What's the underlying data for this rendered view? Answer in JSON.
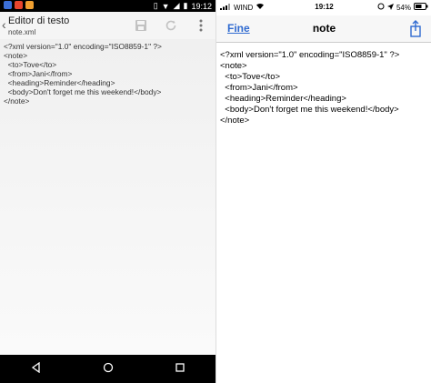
{
  "android": {
    "status_time": "19:12",
    "title": "Editor di testo",
    "subtitle": "note.xml",
    "content_lines": [
      "<?xml version=\"1.0\" encoding=\"ISO8859-1\" ?>",
      "<note>",
      "  <to>Tove</to>",
      "  <from>Jani</from>",
      "  <heading>Reminder</heading>",
      "  <body>Don't forget me this weekend!</body>",
      "</note>"
    ]
  },
  "ios": {
    "carrier": "WIND",
    "status_time": "19:12",
    "battery": "54%",
    "done_label": "Fine",
    "title": "note",
    "content_lines": [
      "<?xml version=\"1.0\" encoding=\"ISO8859-1\" ?>",
      "<note>",
      "  <to>Tove</to>",
      "  <from>Jani</from>",
      "  <heading>Reminder</heading>",
      "  <body>Don't forget me this weekend!</body>",
      "</note>"
    ]
  },
  "colors": {
    "ios_accent": "#2f6ad0",
    "android_bar": "#000000"
  }
}
